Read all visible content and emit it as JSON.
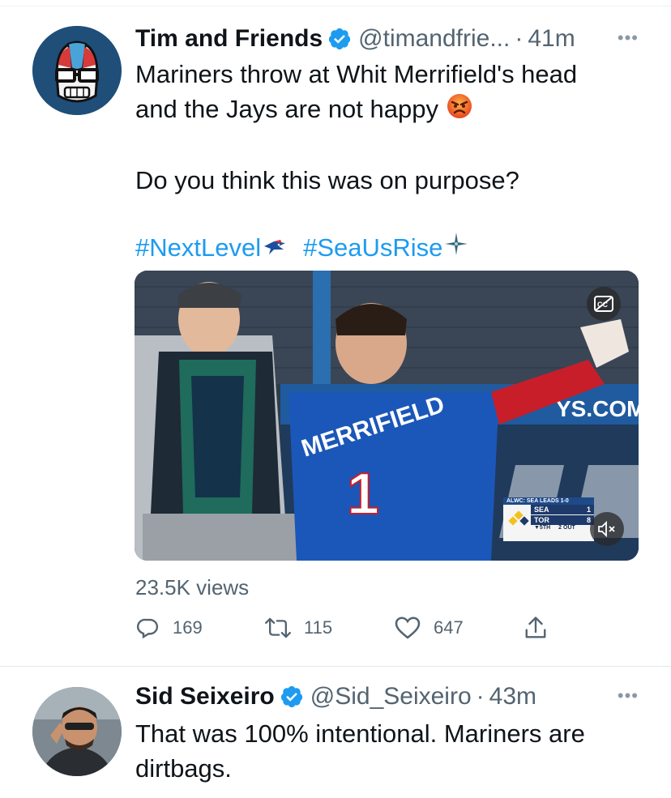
{
  "tweets": [
    {
      "name": "Tim and Friends",
      "handle": "@timandfrie...",
      "time": "41m",
      "more": "•••",
      "text_lines": [
        "Mariners throw at Whit Merrifield's head",
        "and the Jays are not happy"
      ],
      "question": "Do you think this was on purpose?",
      "hashtags": [
        "#NextLevel",
        "#SeaUsRise"
      ],
      "media": {
        "scorebug": {
          "header": "ALWC: SEA LEADS 1-0",
          "rows": [
            {
              "team": "SEA",
              "score": "1"
            },
            {
              "team": "TOR",
              "score": "8"
            }
          ],
          "inning": "▼5TH",
          "outs": "2 OUT"
        },
        "jersey_name": "MERRIFIELD",
        "jersey_number": "1",
        "wall_text": "YS.COM",
        "cc_icon": "closed-captions-icon",
        "mute_icon": "muted-speaker-icon"
      },
      "views": "23.5K views",
      "stats": {
        "replies": "169",
        "retweets": "115",
        "likes": "647"
      },
      "colors": {
        "link": "#1d9bf0",
        "verified": "#1d9bf0",
        "muted_text": "#536471"
      }
    },
    {
      "name": "Sid Seixeiro",
      "handle": "@Sid_Seixeiro",
      "time": "43m",
      "more": "•••",
      "text_lines": [
        "That was 100% intentional. Mariners are",
        "dirtbags."
      ]
    }
  ]
}
